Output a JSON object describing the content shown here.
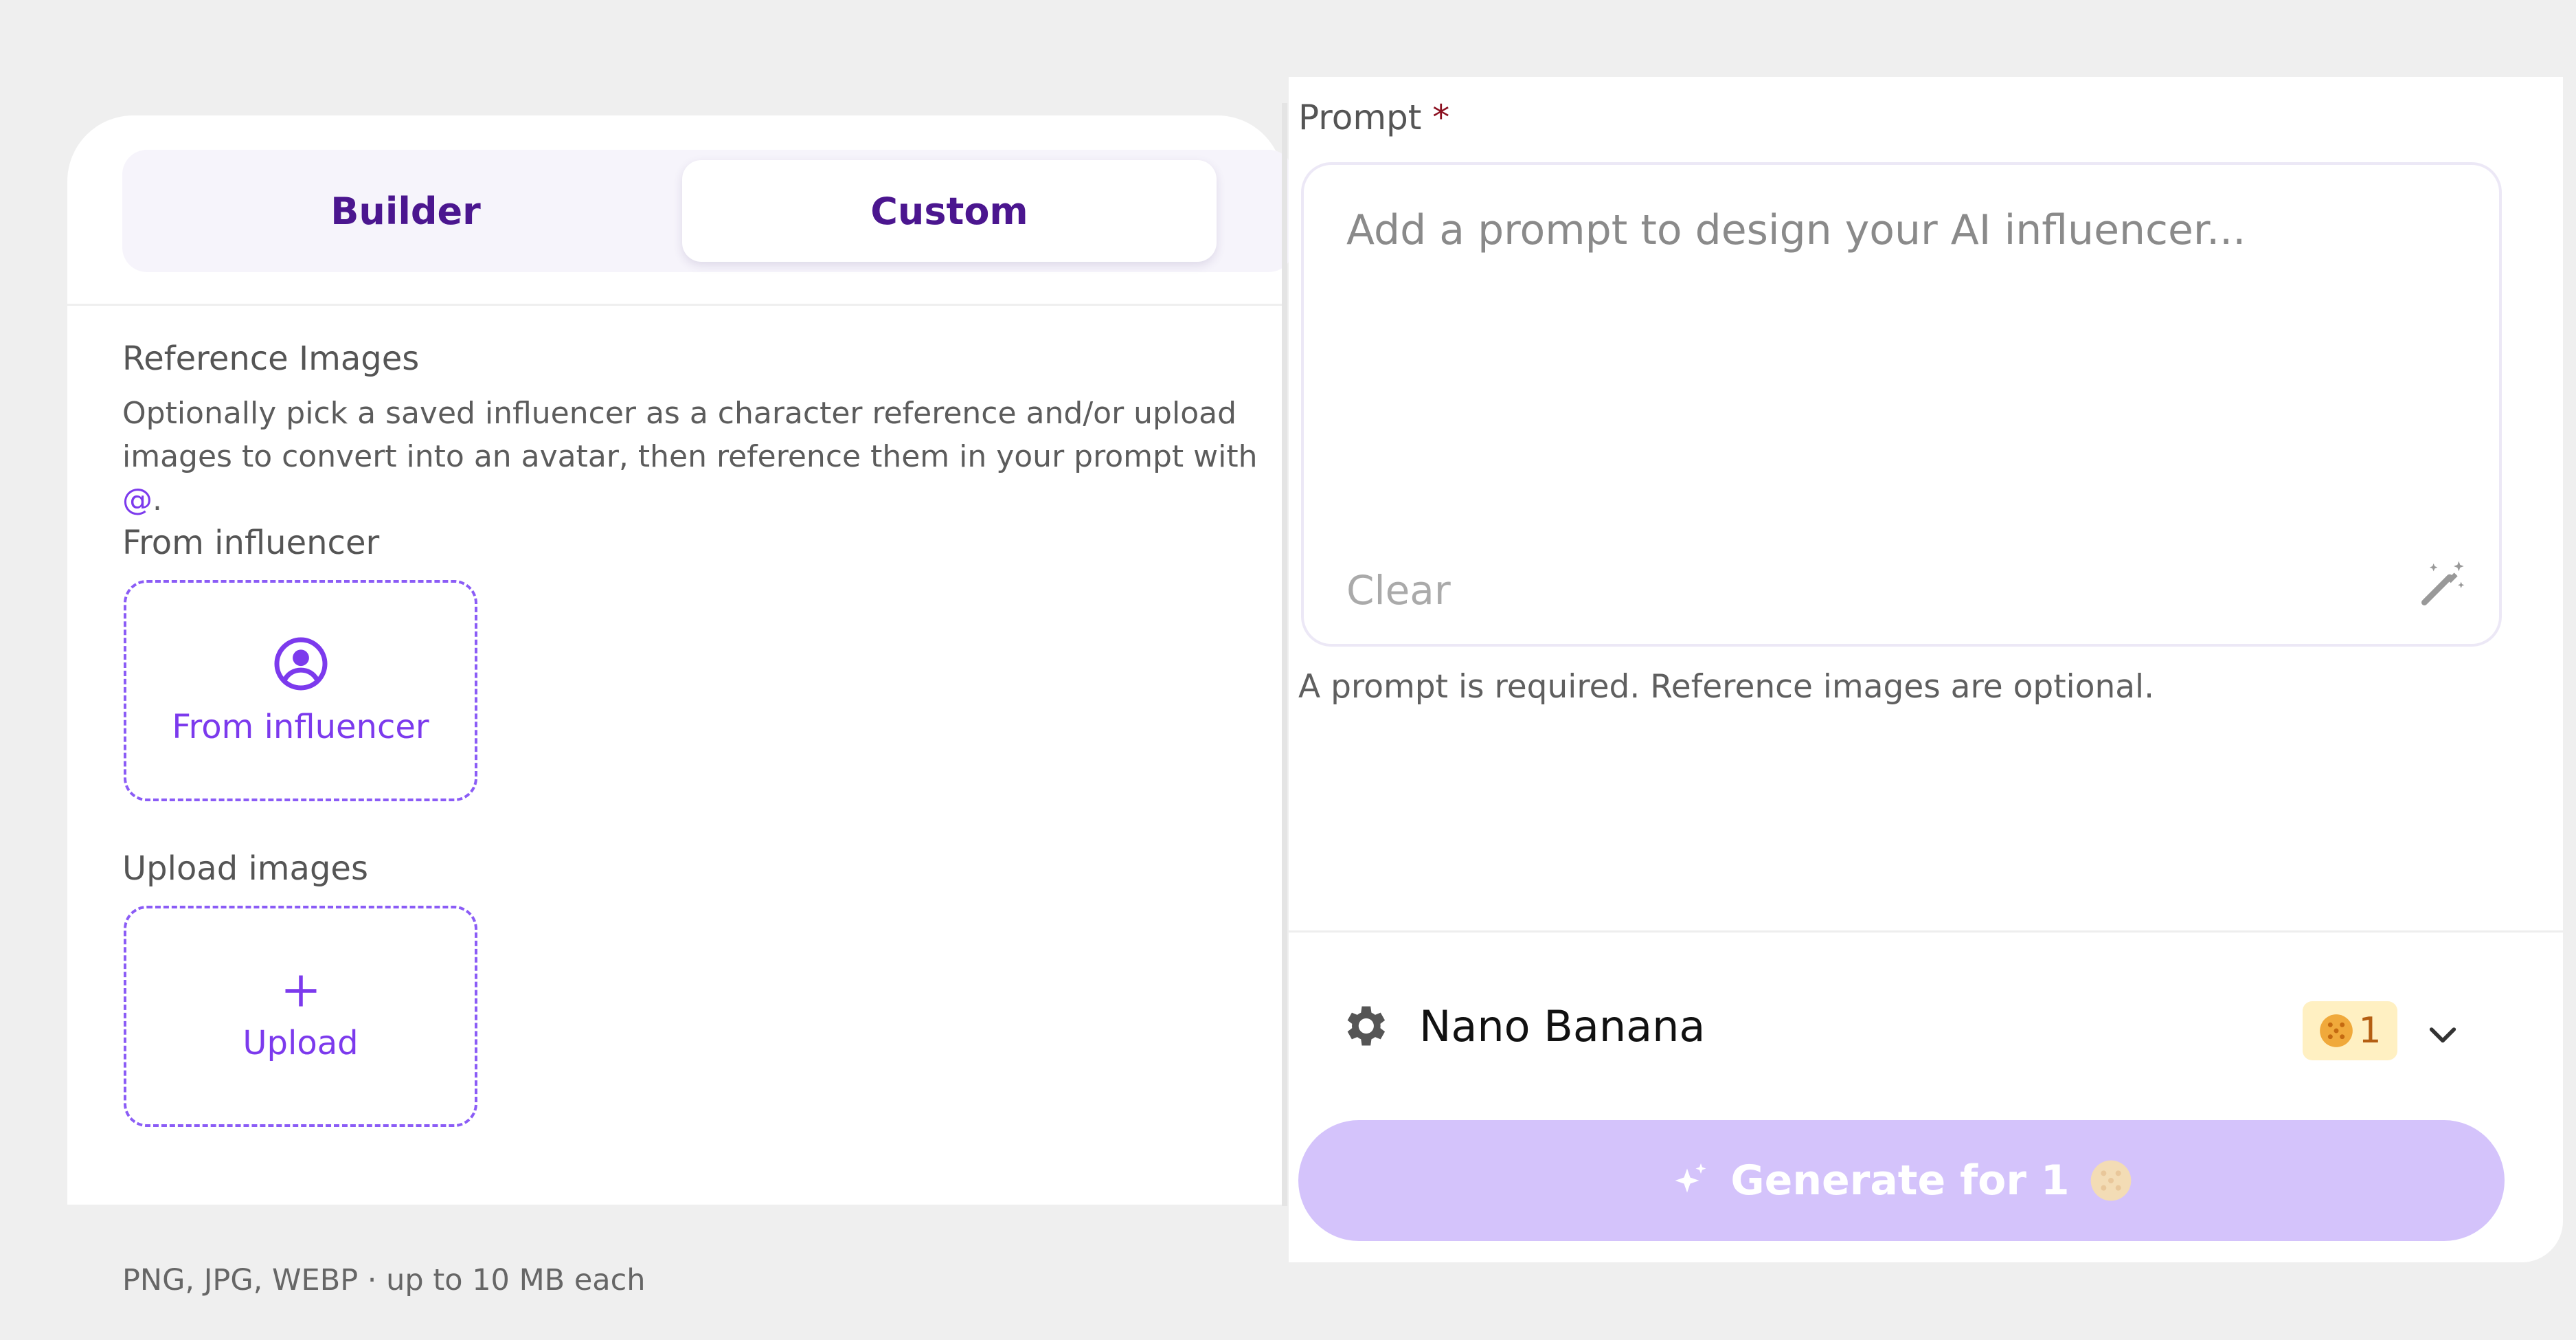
{
  "tabs": [
    {
      "label": "Builder",
      "active": false
    },
    {
      "label": "Custom",
      "active": true
    }
  ],
  "reference": {
    "title": "Reference Images",
    "description": "Optionally pick a saved influencer as a character reference and/or upload images to convert into an avatar, then reference them in your prompt with ",
    "mention_symbol": "@",
    "description_end": "."
  },
  "from_influencer": {
    "section_label": "From influencer",
    "button_label": "From influencer",
    "icon": "user-circle-icon"
  },
  "upload": {
    "section_label": "Upload images",
    "button_label": "Upload",
    "icon": "plus-icon",
    "hint": "PNG, JPG, WEBP · up to 10 MB each"
  },
  "prompt": {
    "label": "Prompt",
    "required_marker": "*",
    "placeholder": "Add a prompt to design your AI influencer...",
    "value": "",
    "clear_label": "Clear",
    "enhance_icon": "magic-wand-icon",
    "note": "A prompt is required. Reference images are optional."
  },
  "model": {
    "icon": "gear-icon",
    "name": "Nano Banana",
    "cost": "1",
    "dropdown_icon": "chevron-down-icon"
  },
  "generate": {
    "label": "Generate for 1",
    "icon": "sparkle-icon",
    "enabled": false
  },
  "colors": {
    "accent": "#7c3aed",
    "tab_text": "#4b168f",
    "generate_disabled": "#d4c3fb",
    "badge_bg": "#fff0c2"
  }
}
